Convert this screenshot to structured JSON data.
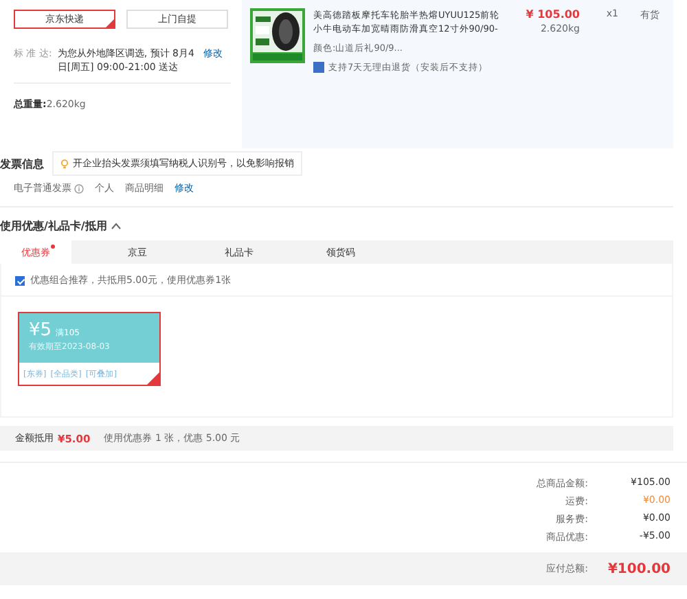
{
  "shipping": {
    "options": [
      {
        "label": "京东快递",
        "selected": true
      },
      {
        "label": "上门自提",
        "selected": false
      }
    ],
    "standard": {
      "label": "标 准 达:",
      "text": "为您从外地降区调选, 预计 8月4日[周五] 09:00-21:00 送达",
      "edit": "修改"
    },
    "weight": {
      "label": "总重量:",
      "value": "2.620kg"
    }
  },
  "product": {
    "title": "美高德踏板摩托车轮胎半热熔UYUU125前轮小牛电动车加宽晴雨防滑真空12寸外90/90-",
    "color_label": "颜色:",
    "variant": "山道后礼90/9...",
    "service": "支持7天无理由退货（安装后不支持）",
    "price": "¥ 105.00",
    "weight": "2.620kg",
    "qty": "x1",
    "stock": "有货"
  },
  "invoice": {
    "title": "发票信息",
    "tip": "开企业抬头发票须填写纳税人识别号，以免影响报销",
    "type": "电子普通发票",
    "person": "个人",
    "content": "商品明细",
    "edit": "修改"
  },
  "coupons": {
    "title": "使用优惠/礼品卡/抵用",
    "expanded": true,
    "tabs": [
      {
        "label": "优惠券",
        "selected": true,
        "marked": true
      },
      {
        "label": "京豆",
        "selected": false,
        "marked": false
      },
      {
        "label": "礼品卡",
        "selected": false,
        "marked": false
      },
      {
        "label": "领货码",
        "selected": false,
        "marked": false
      }
    ],
    "combo": {
      "checked": true,
      "text": "优惠组合推荐，共抵用5.00元，使用优惠券1张"
    },
    "cards": [
      {
        "amount": "¥5",
        "condition": "满105",
        "validity": "有效期至2023-08-03",
        "tags": [
          "[东券]",
          "[全品类]",
          "[可叠加]"
        ],
        "selected": true
      }
    ]
  },
  "deduction": {
    "label": "金额抵用",
    "amount": "¥5.00",
    "detail": "使用优惠券 1 张，优惠 5.00 元"
  },
  "summary": [
    {
      "label": "总商品金额:",
      "value": "¥105.00",
      "kind": "normal"
    },
    {
      "label": "运费:",
      "value": "¥0.00",
      "kind": "highlight"
    },
    {
      "label": "服务费:",
      "value": "¥0.00",
      "kind": "normal"
    },
    {
      "label": "商品优惠:",
      "value": "-¥5.00",
      "kind": "normal"
    }
  ],
  "total": {
    "label": "应付总额:",
    "value": "¥100.00"
  }
}
